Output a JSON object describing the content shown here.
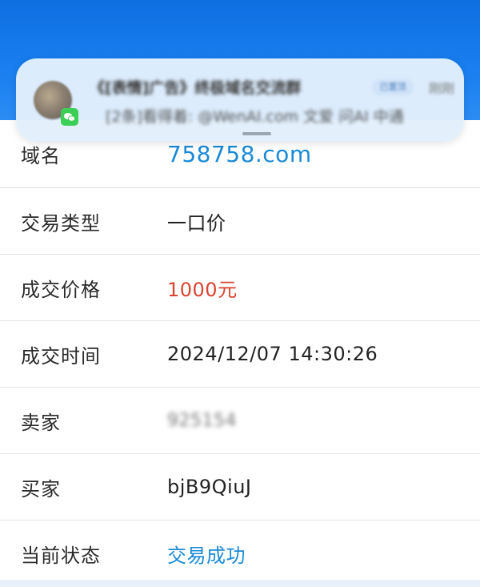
{
  "colors": {
    "header_blue": "#1a7ff0",
    "link_blue": "#1a8ad6",
    "price_red": "#d9432f",
    "notification_bg": "#e2f0fc"
  },
  "notification": {
    "title": "《[表情]广告》终极域名交流群",
    "tag": "已置顶",
    "time": "刚刚",
    "body": "[2条]看得着: @WenAI.com 文爱 问AI 中通",
    "app_icon": "wechat-icon"
  },
  "details": {
    "domain": {
      "label": "域名",
      "value": "758758.com"
    },
    "trade_type": {
      "label": "交易类型",
      "value": "一口价"
    },
    "price": {
      "label": "成交价格",
      "value": "1000元"
    },
    "time": {
      "label": "成交时间",
      "value": "2024/12/07 14:30:26"
    },
    "seller": {
      "label": "卖家",
      "value": "925154"
    },
    "buyer": {
      "label": "买家",
      "value": "bjB9QiuJ"
    },
    "status": {
      "label": "当前状态",
      "value": "交易成功"
    }
  }
}
